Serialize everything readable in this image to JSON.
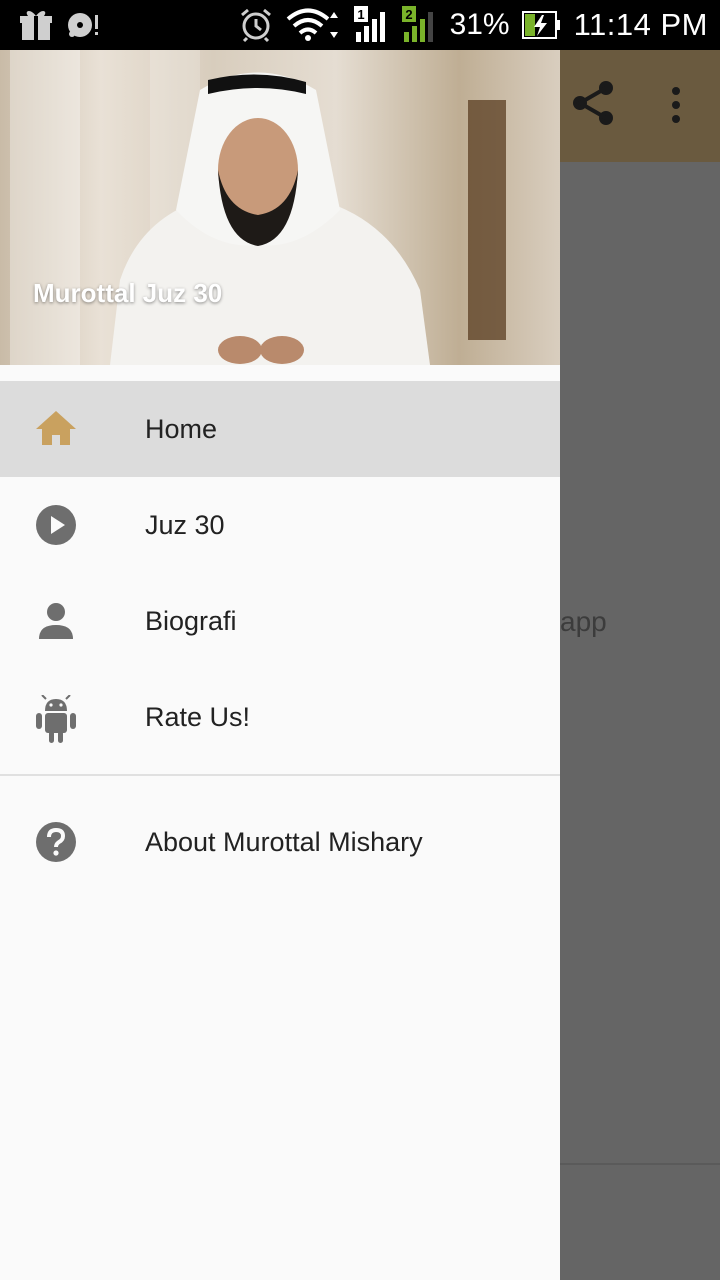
{
  "status_bar": {
    "battery_percent": "31%",
    "time": "11:14 PM",
    "sim1_label": "1",
    "sim2_label": "2"
  },
  "background_app": {
    "visible_text": "app",
    "actions": [
      {
        "icon": "share-icon"
      },
      {
        "icon": "more-vert-icon"
      }
    ]
  },
  "drawer": {
    "header_title": "Murottal Juz 30",
    "items": [
      {
        "label": "Home",
        "icon": "home-icon",
        "active": true
      },
      {
        "label": "Juz 30",
        "icon": "play-circle-icon",
        "active": false
      },
      {
        "label": "Biografi",
        "icon": "person-icon",
        "active": false
      },
      {
        "label": "Rate Us!",
        "icon": "android-icon",
        "active": false
      }
    ],
    "secondary_items": [
      {
        "label": "About Murottal Mishary",
        "icon": "help-circle-icon"
      }
    ]
  },
  "colors": {
    "accent": "#c9a15f",
    "icon_gray": "#6e6e6e",
    "scrim": "#656565"
  }
}
